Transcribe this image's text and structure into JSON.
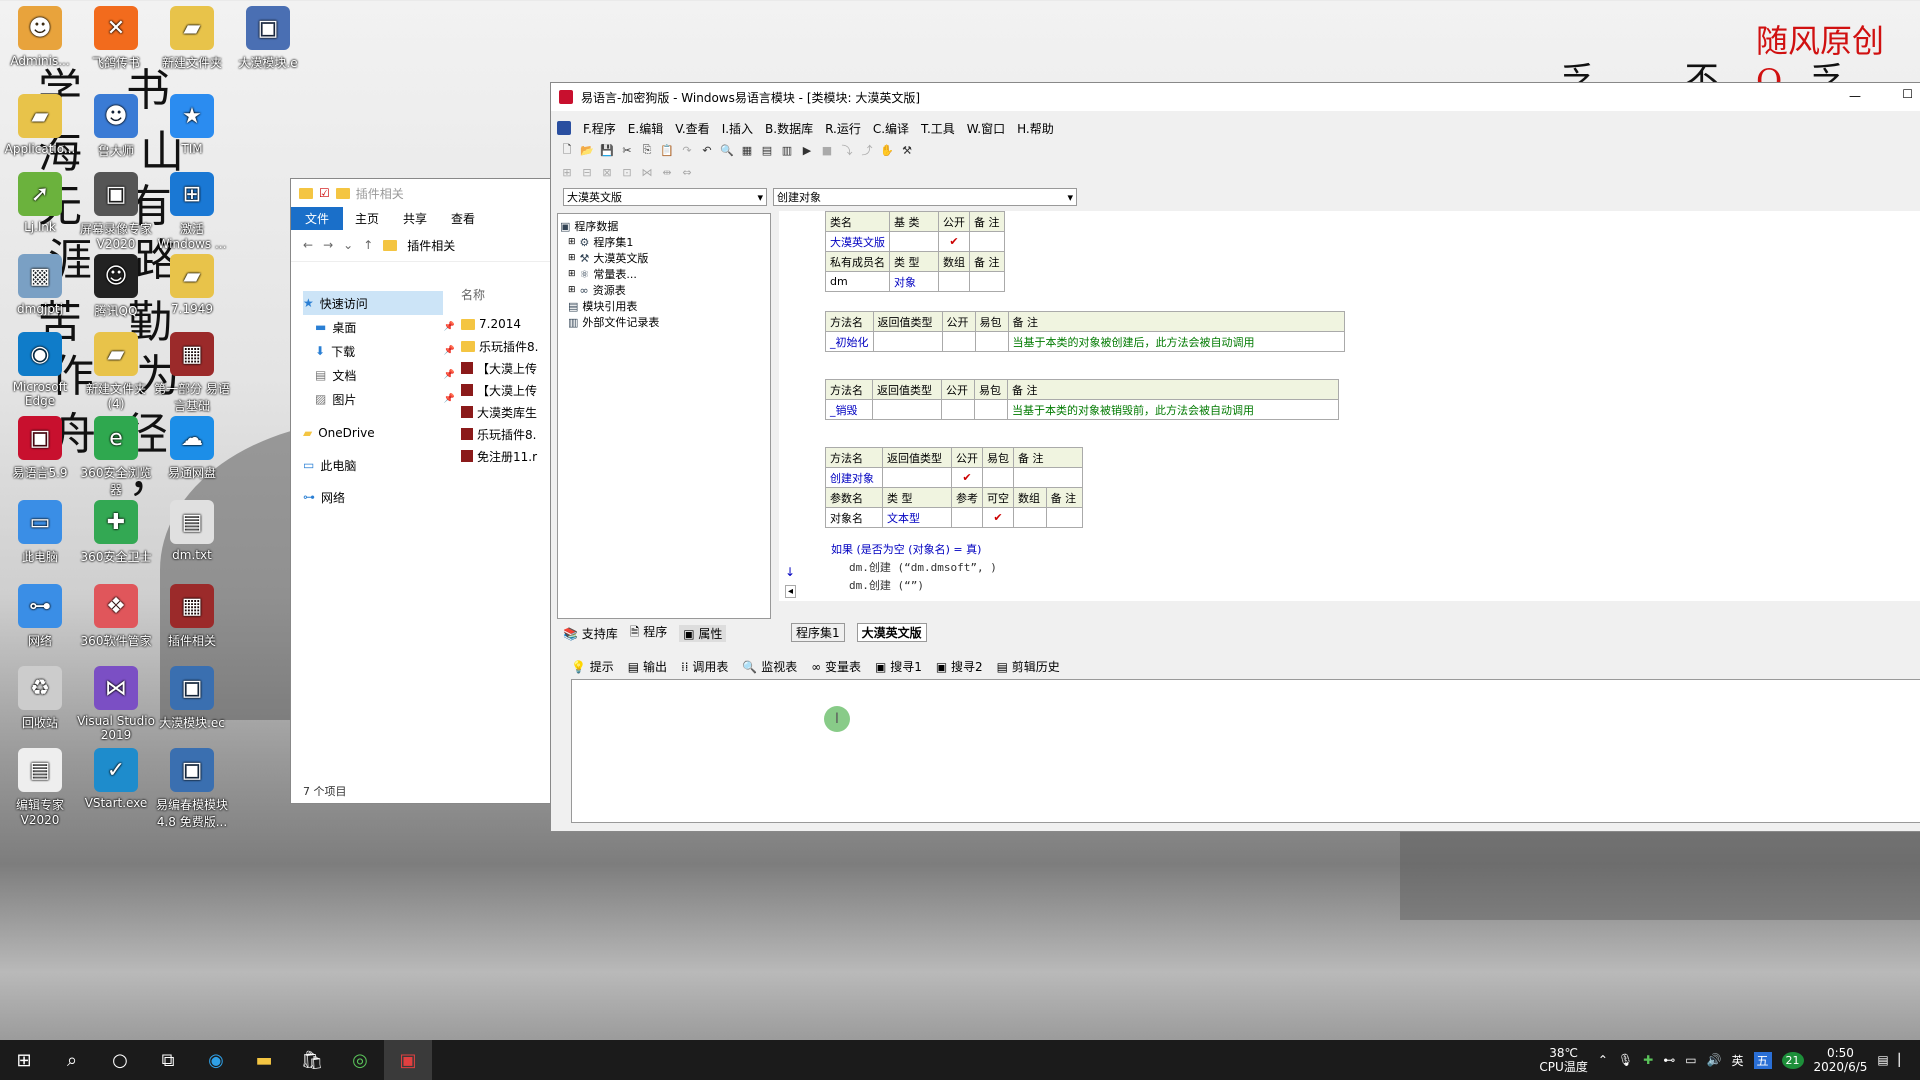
{
  "wallpaper": {
    "red_banner": "随风原创 Q",
    "calligraphy": [
      "学",
      "书",
      "海",
      "山",
      "无",
      "有",
      "涯",
      "路",
      "苦",
      "勤",
      "作",
      "为",
      "舟",
      "径",
      "，"
    ]
  },
  "desktop_icons": [
    {
      "label": "Adminis...",
      "icon": "user-folder-icon",
      "color": "#e8a33c"
    },
    {
      "label": "飞鸽传书",
      "icon": "feige-icon",
      "color": "#f26b1d"
    },
    {
      "label": "新建文件夹",
      "icon": "folder-icon",
      "color": "#e8c34a"
    },
    {
      "label": "大漠模块.e",
      "icon": "e-file-icon",
      "color": "#4a6fb3"
    },
    {
      "label": "Applicatio...",
      "icon": "app-folder-icon",
      "color": "#e8c34a"
    },
    {
      "label": "鲁大师",
      "icon": "ludashi-icon",
      "color": "#3a7bd5"
    },
    {
      "label": "TIM",
      "icon": "tim-icon",
      "color": "#2b8cf0"
    },
    {
      "label": "Lj.lnk",
      "icon": "shortcut-icon",
      "color": "#6bb23d"
    },
    {
      "label": "屏幕录像专家 V2020",
      "icon": "recorder-icon",
      "color": "#555555"
    },
    {
      "label": "激活 Windows ...",
      "icon": "windows-icon",
      "color": "#1a78d4"
    },
    {
      "label": "dmgjptj",
      "icon": "dm-icon",
      "color": "#7aa0c4"
    },
    {
      "label": "腾讯QQ",
      "icon": "qq-icon",
      "color": "#222222"
    },
    {
      "label": "7.1949",
      "icon": "folder-icon",
      "color": "#e8c34a"
    },
    {
      "label": "Microsoft Edge",
      "icon": "edge-icon",
      "color": "#0f7cc9"
    },
    {
      "label": "新建文件夹 (4)",
      "icon": "folder-icon",
      "color": "#e8c34a"
    },
    {
      "label": "第一部分 易语言基础",
      "icon": "archive-icon",
      "color": "#9b2a2a"
    },
    {
      "label": "易语言5.9",
      "icon": "ey-icon",
      "color": "#c8102e"
    },
    {
      "label": "360安全浏览器",
      "icon": "browser360-icon",
      "color": "#2fa84f"
    },
    {
      "label": "易通网盘",
      "icon": "cloud-icon",
      "color": "#1c8ee8"
    },
    {
      "label": "此电脑",
      "icon": "computer-icon",
      "color": "#3a8ee6"
    },
    {
      "label": "360安全卫士",
      "icon": "guard360-icon",
      "color": "#33a853"
    },
    {
      "label": "dm.txt",
      "icon": "text-file-icon",
      "color": "#e0e0e0"
    },
    {
      "label": "网络",
      "icon": "network-icon",
      "color": "#3a8ee6"
    },
    {
      "label": "360软件管家",
      "icon": "softmgr360-icon",
      "color": "#e0565b"
    },
    {
      "label": "插件相关",
      "icon": "archive-icon",
      "color": "#9b2a2a"
    },
    {
      "label": "回收站",
      "icon": "recycle-icon",
      "color": "#cccccc"
    },
    {
      "label": "Visual Studio 2019",
      "icon": "vs-icon",
      "color": "#7b4fc4"
    },
    {
      "label": "大漠模块.ec",
      "icon": "ec-file-icon",
      "color": "#3a6fb0"
    },
    {
      "label": "编辑专家 V2020",
      "icon": "doc-icon",
      "color": "#eeeeee"
    },
    {
      "label": "VStart.exe",
      "icon": "vstart-icon",
      "color": "#1e8ccc"
    },
    {
      "label": "易编春模模块 4.8 免费版...",
      "icon": "module-icon",
      "color": "#3a6fb0"
    }
  ],
  "explorer": {
    "title": "插件相关",
    "ribbon": [
      "文件",
      "主页",
      "共享",
      "查看"
    ],
    "address": "插件相关",
    "nav": [
      {
        "label": "快速访问",
        "icon": "star-icon",
        "pin": false
      },
      {
        "label": "桌面",
        "icon": "desktop-icon",
        "pin": true
      },
      {
        "label": "下载",
        "icon": "download-icon",
        "pin": true
      },
      {
        "label": "文档",
        "icon": "document-icon",
        "pin": true
      },
      {
        "label": "图片",
        "icon": "picture-icon",
        "pin": true
      },
      {
        "label": "OneDrive",
        "icon": "onedrive-icon",
        "pin": false
      },
      {
        "label": "此电脑",
        "icon": "computer-icon",
        "pin": false
      },
      {
        "label": "网络",
        "icon": "network-icon",
        "pin": false
      }
    ],
    "column_header": "名称",
    "files": [
      {
        "name": "7.2014",
        "type": "folder"
      },
      {
        "name": "乐玩插件8.",
        "type": "folder"
      },
      {
        "name": "【大漠上传",
        "type": "rar"
      },
      {
        "name": "【大漠上传",
        "type": "rar"
      },
      {
        "name": "大漠类库生",
        "type": "rar"
      },
      {
        "name": "乐玩插件8.",
        "type": "rar"
      },
      {
        "name": "免注册11.r",
        "type": "rar"
      }
    ],
    "status": "7 个项目"
  },
  "ide": {
    "title": "易语言-加密狗版 - Windows易语言模块 - [类模块: 大漠英文版]",
    "menu": [
      "F.程序",
      "E.编辑",
      "V.查看",
      "I.插入",
      "B.数据库",
      "R.运行",
      "C.编译",
      "T.工具",
      "W.窗口",
      "H.帮助"
    ],
    "class_select": "大漠英文版",
    "method_select": "创建对象",
    "tree": [
      {
        "label": "程序数据",
        "level": 0,
        "icon": "program-data-icon"
      },
      {
        "label": "程序集1",
        "level": 1,
        "icon": "assembly-icon"
      },
      {
        "label": "大漠英文版",
        "level": 1,
        "icon": "class-icon"
      },
      {
        "label": "常量表...",
        "level": 1,
        "icon": "constant-icon"
      },
      {
        "label": "资源表",
        "level": 1,
        "icon": "resource-icon"
      },
      {
        "label": "模块引用表",
        "level": 1,
        "icon": "module-ref-icon"
      },
      {
        "label": "外部文件记录表",
        "level": 1,
        "icon": "external-file-icon"
      }
    ],
    "class_table": {
      "headers": [
        "类名",
        "基 类",
        "公开",
        "备 注"
      ],
      "row": [
        "大漠英文版",
        "",
        "✔",
        ""
      ],
      "member_headers": [
        "私有成员名",
        "类 型",
        "数组",
        "备 注"
      ],
      "member_row": [
        "dm",
        "对象",
        "",
        ""
      ]
    },
    "method1": {
      "headers": [
        "方法名",
        "返回值类型",
        "公开",
        "易包",
        "备 注"
      ],
      "row": [
        "_初始化",
        "",
        "",
        "",
        "当基于本类的对象被创建后，此方法会被自动调用"
      ]
    },
    "method2": {
      "headers": [
        "方法名",
        "返回值类型",
        "公开",
        "易包",
        "备 注"
      ],
      "row": [
        "_销毁",
        "",
        "",
        "",
        "当基于本类的对象被销毁前，此方法会被自动调用"
      ]
    },
    "method3": {
      "headers": [
        "方法名",
        "返回值类型",
        "公开",
        "易包",
        "备 注"
      ],
      "row": [
        "创建对象",
        "",
        "✔",
        "",
        ""
      ],
      "param_headers": [
        "参数名",
        "类 型",
        "参考",
        "可空",
        "数组",
        "备 注"
      ],
      "param_row": [
        "对象名",
        "文本型",
        "",
        "✔",
        "",
        ""
      ]
    },
    "code_lines": [
      "如果 (是否为空 (对象名) = 真)",
      "dm.创建 (“dm.dmsoft”, )",
      "dm.创建 (“”)"
    ],
    "left_tabs": [
      "支持库",
      "程序",
      "属性"
    ],
    "editor_tabs": [
      "程序集1",
      "大漠英文版"
    ],
    "output_tabs": [
      "提示",
      "输出",
      "调用表",
      "监视表",
      "变量表",
      "搜寻1",
      "搜寻2",
      "剪辑历史"
    ]
  },
  "taskbar": {
    "temp": "38℃",
    "temp_label": "CPU温度",
    "ime": "英",
    "ime2": "五",
    "badge": "21",
    "time": "0:50",
    "date": "2020/6/5"
  }
}
